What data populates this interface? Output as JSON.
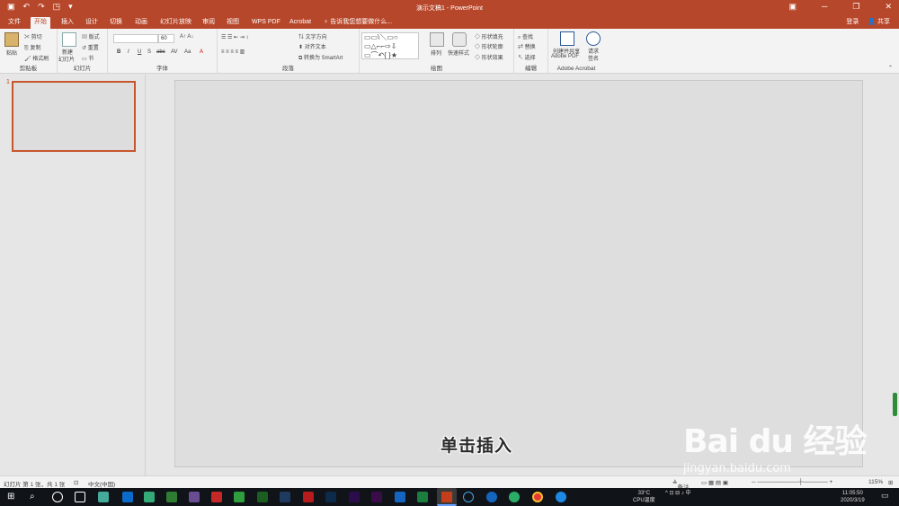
{
  "titlebar": {
    "title": "演示文稿1 - PowerPoint",
    "qat": [
      "save-icon",
      "undo-icon",
      "redo-icon",
      "present-icon"
    ],
    "win_min": "─",
    "win_restore": "❐",
    "win_close": "✕",
    "ribbon_opts": "▣"
  },
  "tabs": [
    "文件",
    "开始",
    "插入",
    "设计",
    "切换",
    "动画",
    "幻灯片放映",
    "审阅",
    "视图",
    "WPS PDF",
    "Acrobat"
  ],
  "tellme": "告诉我您想要做什么...",
  "account": {
    "login": "登录",
    "share": "共享"
  },
  "ribbon": {
    "clipboard": {
      "paste": "粘贴",
      "cut": "剪切",
      "copy": "复制",
      "format": "格式刷",
      "label": "剪贴板"
    },
    "slides": {
      "new": "新建",
      "new2": "幻灯片",
      "layout": "版式",
      "reset": "重置",
      "section": "节",
      "label": "幻灯片"
    },
    "font": {
      "size": "60",
      "label": "字体",
      "bold": "B",
      "italic": "I",
      "underline": "U",
      "strike": "S",
      "abc": "abc",
      "av": "AV",
      "aa": "Aa",
      "a": "A"
    },
    "paragraph": {
      "dir": "文字方向",
      "align": "对齐文本",
      "smartart": "转换为 SmartArt",
      "label": "段落"
    },
    "drawing": {
      "arrange": "排列",
      "quick": "快速样式",
      "fill": "形状填充",
      "outline": "形状轮廓",
      "effect": "形状效果",
      "label": "绘图"
    },
    "editing": {
      "find": "查找",
      "replace": "替换",
      "select": "选择",
      "label": "编辑"
    },
    "acrobat": {
      "create": "创建并共享",
      "create2": "Adobe PDF",
      "request": "请求",
      "request2": "签名",
      "label": "Adobe Acrobat"
    }
  },
  "thumbs": {
    "number": "1"
  },
  "slide": {
    "caption": "单击插入"
  },
  "watermark": {
    "text": "Bai du 经验",
    "url": "jingyan.baidu.com"
  },
  "status": {
    "slide_info": "幻灯片 第 1 张，共 1 张",
    "lang": "中文(中国)",
    "notes": "备注",
    "zoom": "115%"
  },
  "taskbar": {
    "temp": "33°C",
    "cpu": "CPU温度",
    "time": "11:05:50",
    "date": "2020/3/19"
  }
}
